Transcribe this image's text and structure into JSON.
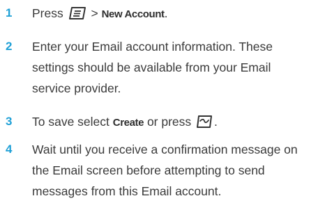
{
  "steps": [
    {
      "number": "1",
      "parts": {
        "a": "Press",
        "b": ">",
        "c": "New Account",
        "d": "."
      },
      "icon": "menu-key-icon"
    },
    {
      "number": "2",
      "lines": [
        "Enter your Email account information. These",
        "settings should be available from your Email",
        "service provider."
      ]
    },
    {
      "number": "3",
      "parts": {
        "a": "To save select",
        "b": "Create",
        "c": "or press",
        "d": "."
      },
      "icon": "center-select-key-icon"
    },
    {
      "number": "4",
      "lines": [
        "Wait until you receive a confirmation message on",
        "the Email screen before attempting to send",
        "messages from this Email account."
      ]
    }
  ],
  "colors": {
    "step_number": "#1fa0d6",
    "body_text": "#3a3a3a"
  }
}
